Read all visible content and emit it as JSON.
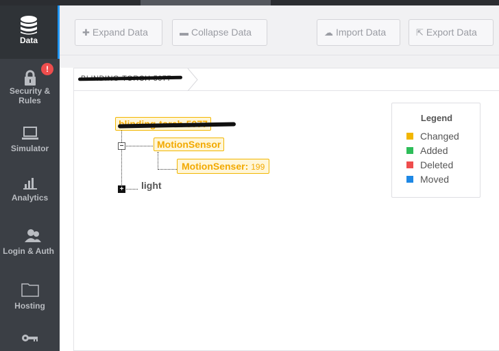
{
  "sidebar": {
    "items": [
      {
        "label": "Data",
        "icon": "database-icon",
        "active": true
      },
      {
        "label": "Security &\nRules",
        "line1": "Security &",
        "line2": "Rules",
        "icon": "lock-icon"
      },
      {
        "label": "Simulator",
        "icon": "laptop-icon"
      },
      {
        "label": "Analytics",
        "icon": "bar-chart-icon"
      },
      {
        "label": "Login & Auth",
        "icon": "users-icon"
      },
      {
        "label": "Hosting",
        "icon": "folder-icon"
      },
      {
        "label": "",
        "icon": "key-icon"
      }
    ],
    "alert_badge": "!"
  },
  "toolbar": {
    "expand_label": "Expand Data",
    "collapse_label": "Collapse Data",
    "import_label": "Import Data",
    "export_label": "Export Data"
  },
  "breadcrumb": {
    "text": "BLINDING-TORCH-5077"
  },
  "tree": {
    "root": {
      "label": "blinding-torch-5077"
    },
    "motion_sensor": {
      "label": "MotionSensor"
    },
    "motion_senser": {
      "key": "MotionSenser:",
      "value": "199"
    },
    "light": {
      "label": "light"
    }
  },
  "legend": {
    "title": "Legend",
    "items": [
      {
        "label": "Changed",
        "color": "#f2b600"
      },
      {
        "label": "Added",
        "color": "#2ebd59"
      },
      {
        "label": "Deleted",
        "color": "#ef4d4d"
      },
      {
        "label": "Moved",
        "color": "#1e88e5"
      }
    ]
  },
  "colors": {
    "sidebar_bg": "#3b3f45",
    "accent": "#2196f3",
    "changed": "#f2b600"
  }
}
